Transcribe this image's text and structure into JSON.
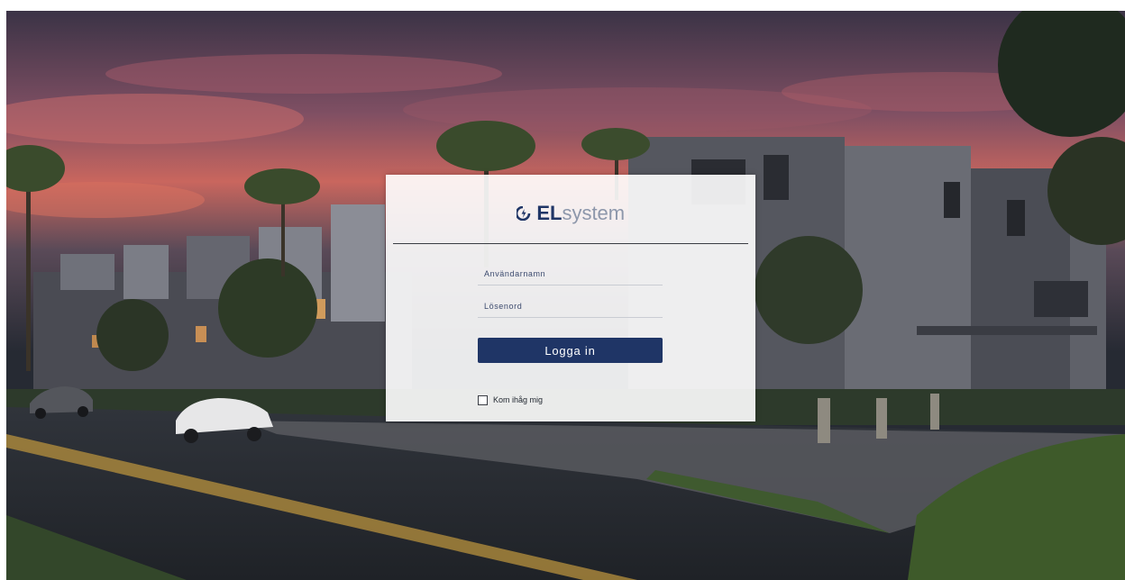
{
  "brand": {
    "logo_bold": "EL",
    "logo_light": "system",
    "primary_color": "#1f3566",
    "secondary_color": "#8d97ab"
  },
  "login": {
    "username_placeholder": "Användarnamn",
    "password_placeholder": "Lösenord",
    "submit_label": "Logga in",
    "remember_label": "Kom ihåg mig",
    "remember_checked": false
  },
  "background": {
    "scene": "townhouses-at-dusk",
    "sky_colors": [
      "#3b3346",
      "#8a5262",
      "#d1675c"
    ]
  },
  "icons": {
    "logo": "elsystem-logo-icon",
    "checkbox": "checkbox-icon"
  }
}
